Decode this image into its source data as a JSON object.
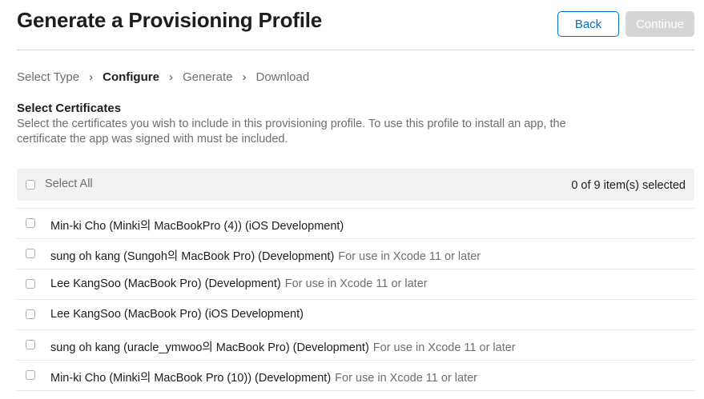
{
  "header": {
    "title": "Generate a Provisioning Profile",
    "back_label": "Back",
    "continue_label": "Continue"
  },
  "steps": [
    {
      "label": "Select Type",
      "active": false
    },
    {
      "label": "Configure",
      "active": true
    },
    {
      "label": "Generate",
      "active": false
    },
    {
      "label": "Download",
      "active": false
    }
  ],
  "certificates": {
    "title": "Select Certificates",
    "description": "Select the certificates you wish to include in this provisioning profile. To use this profile to install an app, the certificate the app was signed with must be included.",
    "select_all_label": "Select All",
    "selected_count": "0 of 9 item(s) selected",
    "items": [
      {
        "name": "Min-ki Cho (Minki의 MacBookPro (4)) (iOS Development)",
        "note": "",
        "checked": false
      },
      {
        "name": "sung oh kang (Sungoh의 MacBook Pro) (Development)",
        "note": "For use in Xcode 11 or later",
        "checked": false
      },
      {
        "name": "Lee KangSoo (MacBook Pro) (Development)",
        "note": "For use in Xcode 11 or later",
        "checked": false
      },
      {
        "name": "Lee KangSoo (MacBook Pro) (iOS Development)",
        "note": "",
        "checked": false
      },
      {
        "name": "sung oh kang (uracle_ymwoo의 MacBook Pro) (Development)",
        "note": "For use in Xcode 11 or later",
        "checked": false
      },
      {
        "name": "Min-ki Cho (Minki의 MacBook Pro (10)) (Development)",
        "note": "For use in Xcode 11 or later",
        "checked": false
      }
    ]
  },
  "colors": {
    "accent": "#0070c9",
    "disabled_button": "#d6d6d6",
    "secondary_text": "#6e6e73"
  }
}
